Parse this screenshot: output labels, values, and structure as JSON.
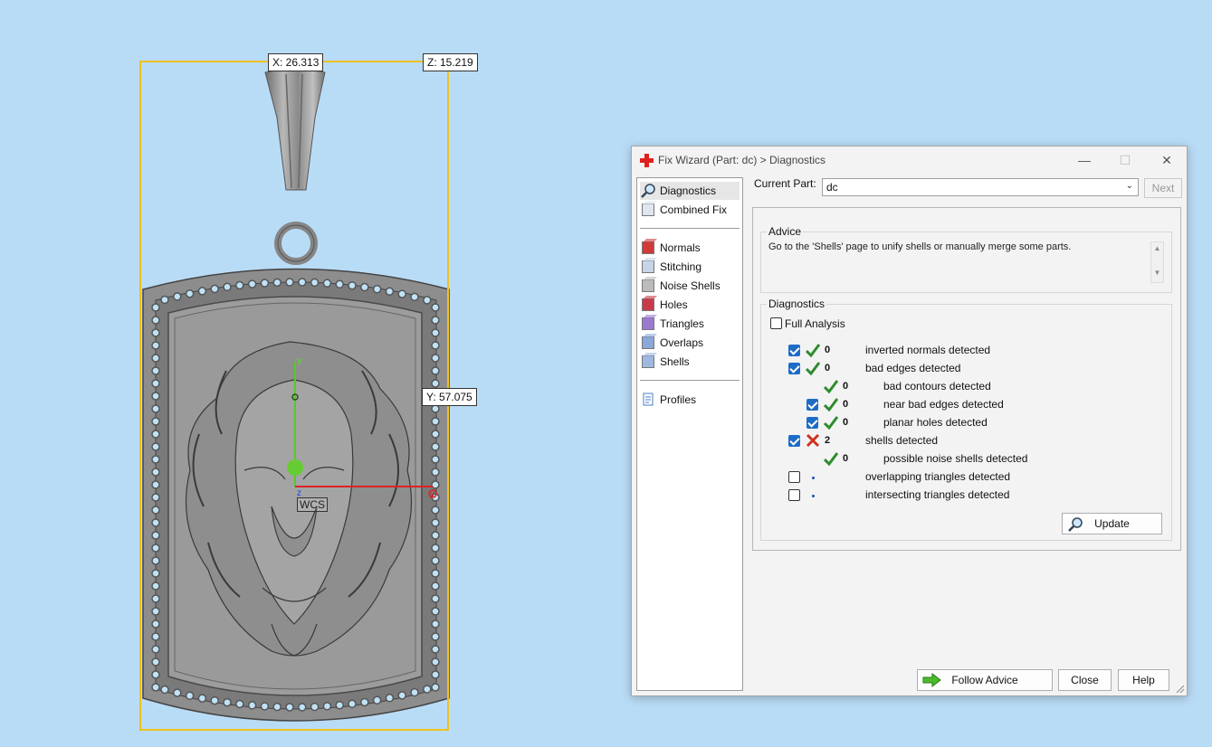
{
  "viewport": {
    "dim_x": "X: 26.313",
    "dim_z": "Z: 15.219",
    "dim_y": "Y: 57.075",
    "axis_y": "y",
    "axis_x": "x",
    "axis_z": "z",
    "wcs": "WCS"
  },
  "dialog": {
    "title": "Fix Wizard (Part: dc) > Diagnostics",
    "controls": {
      "minimize": "—",
      "maximize": "☐",
      "close": "✕"
    },
    "current_part_label": "Current Part:",
    "current_part_value": "dc",
    "next_label": "Next",
    "nav": [
      {
        "label": "Diagnostics",
        "icon": "magnifier-icon"
      },
      {
        "label": "Combined Fix",
        "icon": "combined-fix-icon"
      },
      {
        "label": "Normals",
        "icon": "normals-icon"
      },
      {
        "label": "Stitching",
        "icon": "stitching-icon"
      },
      {
        "label": "Noise Shells",
        "icon": "noise-shells-icon"
      },
      {
        "label": "Holes",
        "icon": "holes-icon"
      },
      {
        "label": "Triangles",
        "icon": "triangles-icon"
      },
      {
        "label": "Overlaps",
        "icon": "overlaps-icon"
      },
      {
        "label": "Shells",
        "icon": "shells-icon"
      },
      {
        "label": "Profiles",
        "icon": "profiles-icon"
      }
    ],
    "advice_title": "Advice",
    "advice_text": "Go to the 'Shells' page to unify shells or manually merge some parts.",
    "diagnostics_title": "Diagnostics",
    "full_analysis_label": "Full Analysis",
    "rows": [
      {
        "count": "0",
        "label": "inverted normals detected"
      },
      {
        "count": "0",
        "label": "bad edges detected"
      },
      {
        "count": "0",
        "label": "bad contours detected"
      },
      {
        "count": "0",
        "label": "near bad edges detected"
      },
      {
        "count": "0",
        "label": "planar holes detected"
      },
      {
        "count": "2",
        "label": "shells detected"
      },
      {
        "count": "0",
        "label": "possible noise shells detected"
      },
      {
        "count": "",
        "label": "overlapping triangles detected"
      },
      {
        "count": "",
        "label": "intersecting triangles detected"
      }
    ],
    "update_label": "Update",
    "follow_advice_label": "Follow Advice",
    "close_label": "Close",
    "help_label": "Help"
  },
  "colors": {
    "background": "#b9dcf6",
    "bbox": "#f0c020",
    "check_ok": "#2e8b2e",
    "check_fail": "#d03020",
    "checkbox_on": "#1d6cc7"
  }
}
